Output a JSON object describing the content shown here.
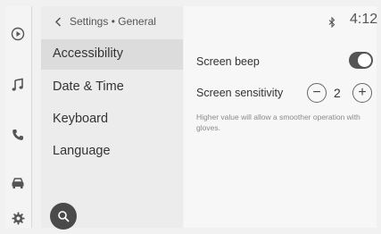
{
  "header": {
    "breadcrumb": "Settings • General",
    "clock": "4:12"
  },
  "sidebar_rail": {
    "icons": [
      "media-play-icon",
      "music-note-icon",
      "phone-icon",
      "car-icon",
      "gear-icon"
    ]
  },
  "settings_list": {
    "items": [
      {
        "label": "Accessibility",
        "selected": true
      },
      {
        "label": "Date & Time",
        "selected": false
      },
      {
        "label": "Keyboard",
        "selected": false
      },
      {
        "label": "Language",
        "selected": false
      }
    ]
  },
  "content": {
    "screen_beep": {
      "label": "Screen beep",
      "enabled": true
    },
    "screen_sensitivity": {
      "label": "Screen sensitivity",
      "value": "2",
      "minus": "−",
      "plus": "+"
    },
    "hint": "Higher value will allow a smoother operation with gloves."
  },
  "colors": {
    "toggle_on": "#555555",
    "search_button": "#4a4a4a"
  }
}
